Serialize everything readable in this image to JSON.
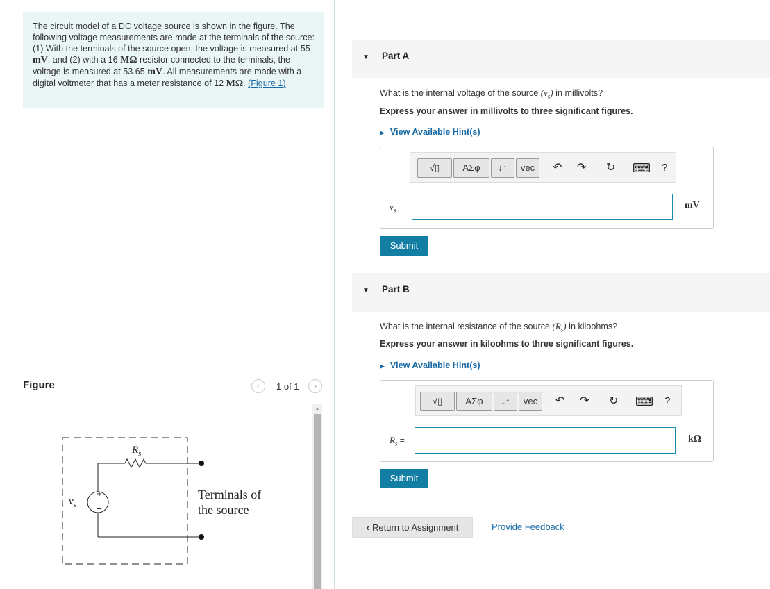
{
  "problem": {
    "text_1": "The circuit model of a DC voltage source is shown in the figure. The following voltage measurements are made at the terminals of the source: (1) With the terminals of the source open, the voltage is measured at 55 ",
    "u1": "mV",
    "text_2": ", and (2) with a 16 ",
    "u2": "MΩ",
    "text_3": " resistor connected to the terminals, the voltage is measured at 53.65 ",
    "u3": "mV",
    "text_4": ". All measurements are made with a digital voltmeter that has a meter resistance of 12 ",
    "u4": "MΩ",
    "text_5": ". ",
    "figure_link": "(Figure 1)"
  },
  "figure": {
    "title": "Figure",
    "pager_count": "1 of 1",
    "prev_icon": "‹",
    "next_icon": "›",
    "circuit": {
      "resistor_label": "R",
      "resistor_sub": "s",
      "source_label": "v",
      "source_sub": "s",
      "plus": "+",
      "minus": "−",
      "terminals_line1": "Terminals of",
      "terminals_line2": "the source"
    }
  },
  "parts": [
    {
      "label": "Part A",
      "q_pre": "What is the internal voltage of the source ",
      "q_var": "(v",
      "q_sub": "s",
      "q_close": ")",
      "q_post": " in millivolts?",
      "instruction": "Express your answer in millivolts to three significant figures.",
      "hint": "View Available Hint(s)",
      "var_main": "v",
      "var_sub": "s",
      "var_eq": " =",
      "value": "",
      "unit": "mV",
      "submit": "Submit"
    },
    {
      "label": "Part B",
      "q_pre": "What is the internal resistance of the source ",
      "q_var": "(R",
      "q_sub": "s",
      "q_close": ")",
      "q_post": " in kiloohms?",
      "instruction": "Express your answer in kiloohms to three significant figures.",
      "hint": "View Available Hint(s)",
      "var_main": "R",
      "var_sub": "s",
      "var_eq": " =",
      "value": "",
      "unit": "kΩ",
      "submit": "Submit"
    }
  ],
  "toolbar": {
    "templates": "√▯",
    "greek": "ΑΣφ",
    "updown": "↓↑",
    "vec": "vec",
    "undo": "↶",
    "redo": "↷",
    "reset": "↻",
    "keyboard": "⌨",
    "help": "?"
  },
  "footer": {
    "return": "Return to Assignment",
    "return_icon": "‹",
    "feedback": "Provide Feedback"
  },
  "colors": {
    "accent": "#127ea3",
    "link": "#1a6aa6",
    "problem_bg": "#eaf5f6"
  }
}
